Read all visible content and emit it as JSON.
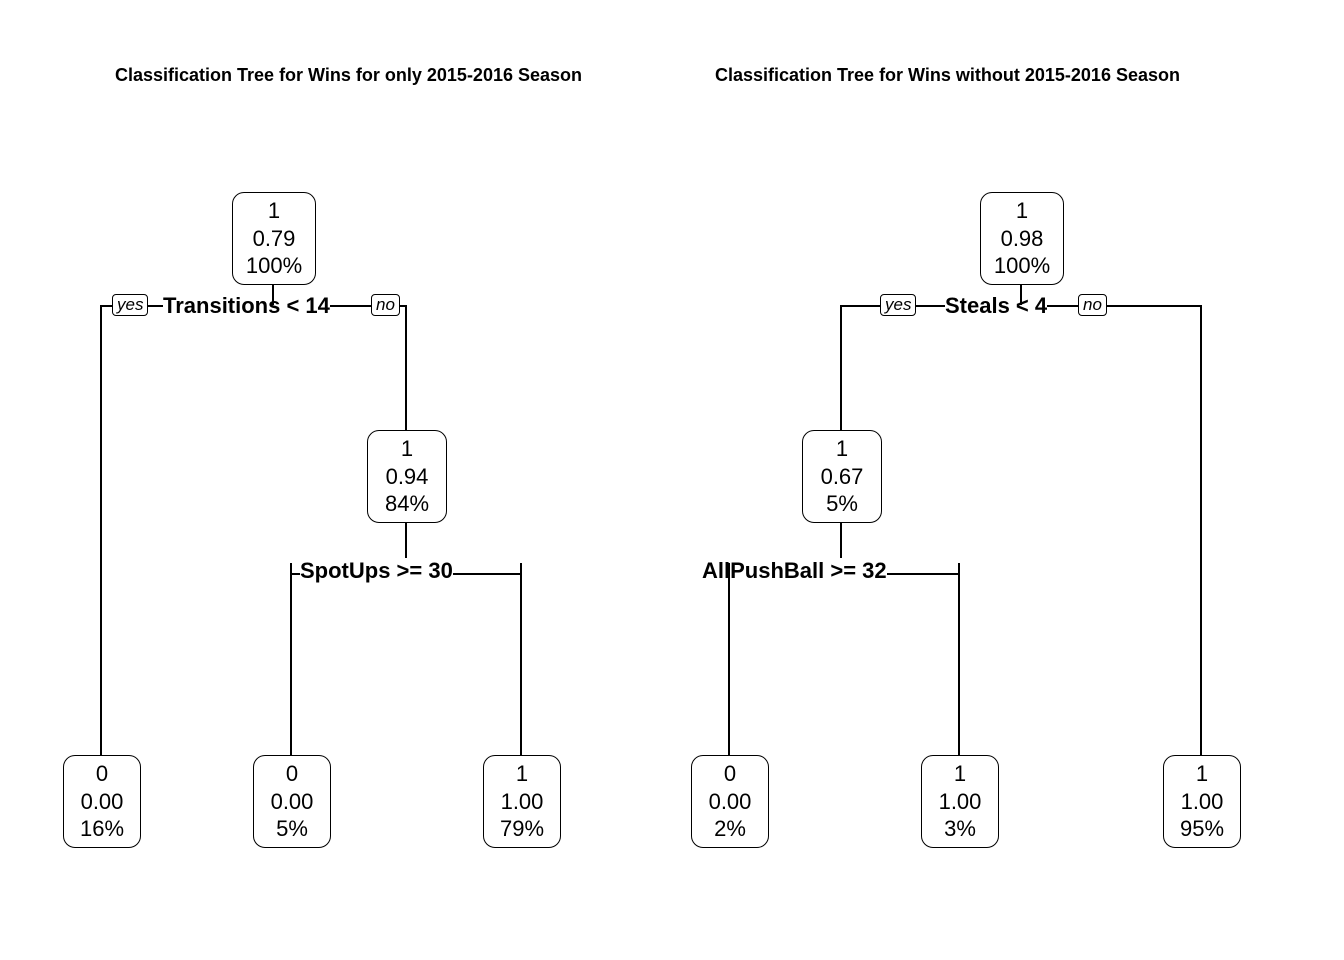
{
  "titles": {
    "left": "Classification Tree for Wins for only 2015-2016 Season",
    "right": "Classification Tree for Wins without 2015-2016 Season"
  },
  "tags": {
    "yes": "yes",
    "no": "no"
  },
  "left_tree": {
    "root": {
      "class": "1",
      "prob": "0.79",
      "pct": "100%"
    },
    "split1": "Transitions < 14",
    "mid": {
      "class": "1",
      "prob": "0.94",
      "pct": "84%"
    },
    "split2": "SpotUps >= 30",
    "leaf_a": {
      "class": "0",
      "prob": "0.00",
      "pct": "16%"
    },
    "leaf_b": {
      "class": "0",
      "prob": "0.00",
      "pct": "5%"
    },
    "leaf_c": {
      "class": "1",
      "prob": "1.00",
      "pct": "79%"
    }
  },
  "right_tree": {
    "root": {
      "class": "1",
      "prob": "0.98",
      "pct": "100%"
    },
    "split1": "Steals < 4",
    "mid": {
      "class": "1",
      "prob": "0.67",
      "pct": "5%"
    },
    "split2": "AllPushBall >= 32",
    "leaf_a": {
      "class": "0",
      "prob": "0.00",
      "pct": "2%"
    },
    "leaf_b": {
      "class": "1",
      "prob": "1.00",
      "pct": "3%"
    },
    "leaf_c": {
      "class": "1",
      "prob": "1.00",
      "pct": "95%"
    }
  }
}
